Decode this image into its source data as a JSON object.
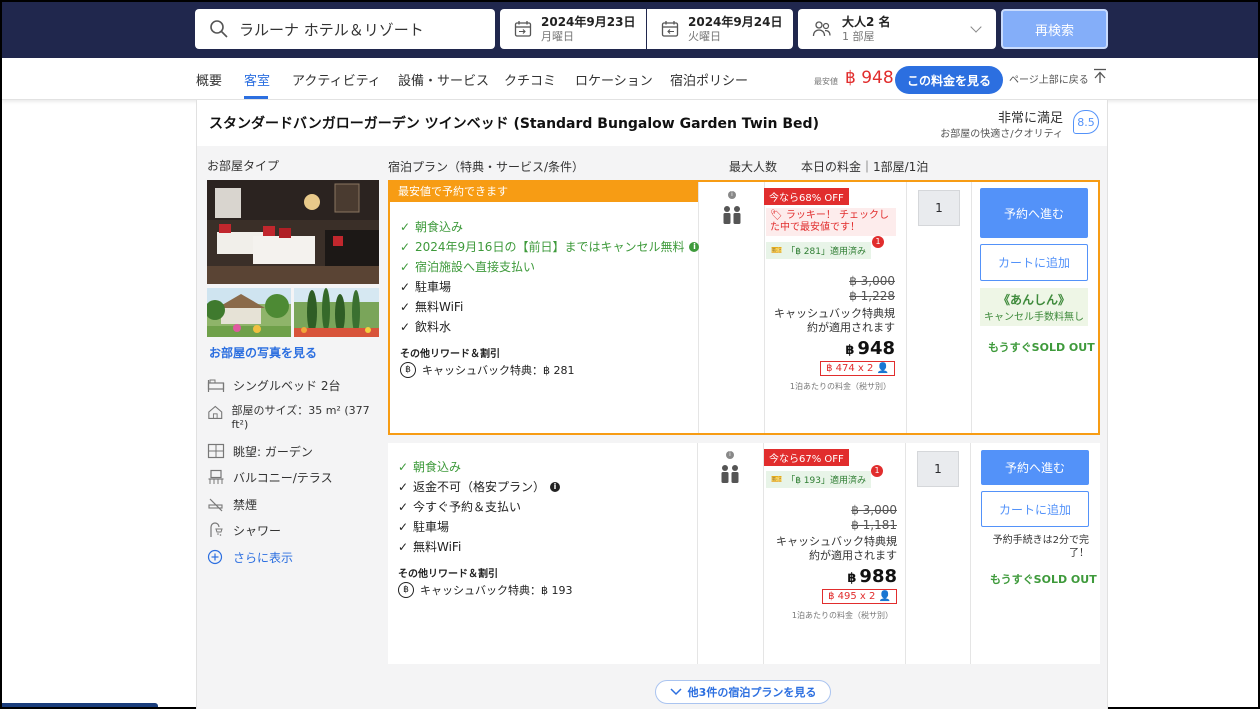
{
  "search": {
    "destination": "ラルーナ ホテル＆リゾート",
    "checkin_date": "2024年9月23日",
    "checkin_day": "月曜日",
    "checkout_date": "2024年9月24日",
    "checkout_day": "火曜日",
    "guests": "大人2 名",
    "rooms": "1 部屋",
    "search_button": "再検索"
  },
  "nav": {
    "tabs": [
      "概要",
      "客室",
      "アクティビティ",
      "設備・サービス",
      "クチコミ",
      "ロケーション",
      "宿泊ポリシー"
    ],
    "active_tab": "客室",
    "min_price_label": "最安値",
    "min_price": "฿ 948",
    "see_price_button": "この料金を見る",
    "back_to_top": "ページ上部に戻る"
  },
  "room": {
    "title": "スタンダードバンガローガーデン ツインベッド (Standard Bungalow Garden Twin Bed)",
    "satisfaction_label": "非常に満足",
    "satisfaction_sub": "お部屋の快適さ/クオリティ",
    "score": "8.5",
    "room_type_header": "お部屋タイプ",
    "see_photos": "お部屋の写真を見る",
    "amenities": [
      "シングルベッド 2台",
      "部屋のサイズ：35 m² (377 ft²)",
      "眺望: ガーデン",
      "バルコニー/テラス",
      "禁煙",
      "シャワー"
    ],
    "show_more": "さらに表示"
  },
  "columns": {
    "plan": "宿泊プラン（特典・サービス/条件）",
    "max_guests": "最大人数",
    "price": "本日の料金｜1部屋/1泊"
  },
  "plans": [
    {
      "badge": "最安値で予約できます",
      "features": [
        {
          "text": "朝食込み",
          "green": true
        },
        {
          "text": "2024年9月16日の【前日】まではキャンセル無料",
          "green": true
        },
        {
          "text": "宿泊施設へ直接支払い",
          "green": true
        },
        {
          "text": "駐車場",
          "green": false
        },
        {
          "text": "無料WiFi",
          "green": false
        },
        {
          "text": "飲料水",
          "green": false
        }
      ],
      "rewards_title": "その他リワード＆割引",
      "cashback": "キャッシュバック特典：฿ 281",
      "off_tag": "今なら68% OFF",
      "lucky": "ラッキー！ チェックした中で最安値です！",
      "applied": "「฿ 281」適用済み",
      "strike1": "฿ 3,000",
      "strike2": "฿ 1,228",
      "note": "キャッシュバック特典規約が適用されます",
      "price": "948",
      "currency": "฿",
      "per_pax": "฿ 474 x 2",
      "per_night": "1泊あたりの料金（税サ別）",
      "qty": "1",
      "book": "予約へ進む",
      "cart": "カートに追加",
      "anshin_title": "《あんしん》",
      "anshin_sub": "キャンセル手数料無し",
      "soldout": "もうすぐSOLD OUT"
    },
    {
      "features": [
        {
          "text": "朝食込み",
          "green": true
        },
        {
          "text": "返金不可（格安プラン）",
          "green": false
        },
        {
          "text": "今すぐ予約＆支払い",
          "green": false
        },
        {
          "text": "駐車場",
          "green": false
        },
        {
          "text": "無料WiFi",
          "green": false
        }
      ],
      "rewards_title": "その他リワード＆割引",
      "cashback": "キャッシュバック特典：฿ 193",
      "off_tag": "今なら67% OFF",
      "applied": "「฿ 193」適用済み",
      "strike1": "฿ 3,000",
      "strike2": "฿ 1,181",
      "note": "キャッシュバック特典規約が適用されます",
      "price": "988",
      "currency": "฿",
      "per_pax": "฿ 495 x 2",
      "per_night": "1泊あたりの料金（税サ別）",
      "qty": "1",
      "book": "予約へ進む",
      "cart": "カートに追加",
      "fast": "予約手続きは2分で完了！",
      "soldout": "もうすぐSOLD OUT"
    }
  ],
  "more_plans": "他3件の宿泊プランを見る",
  "colors": {
    "brand_blue": "#2c6fe0",
    "orange": "#f79c14",
    "red": "#e12d2d",
    "green": "#3e9a3b",
    "topbar": "#20274d"
  }
}
